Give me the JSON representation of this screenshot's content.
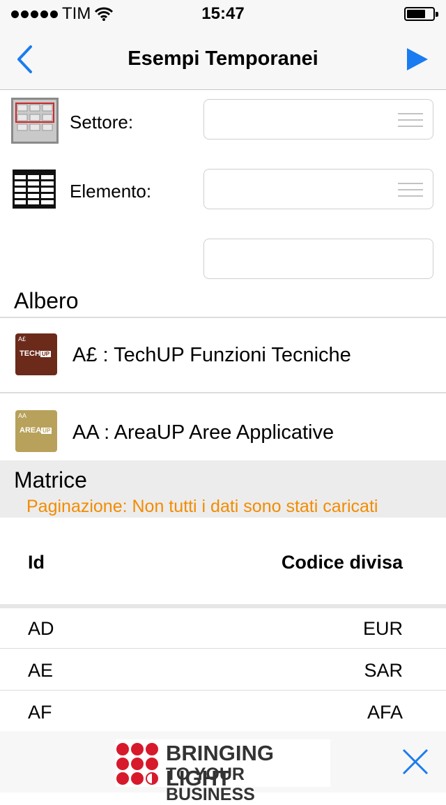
{
  "status": {
    "carrier": "TIM",
    "time": "15:47"
  },
  "nav": {
    "title": "Esempi Temporanei",
    "back_icon": "chevron-left-icon",
    "run_icon": "play-icon",
    "accent": "#1a7cf0"
  },
  "form": {
    "fields": [
      {
        "label": "Settore:",
        "value": ""
      },
      {
        "label": "Elemento:",
        "value": ""
      },
      {
        "label": "",
        "value": ""
      }
    ]
  },
  "tree": {
    "title": "Albero",
    "items": [
      {
        "text": "A£ : TechUP Funzioni Tecniche",
        "icon_small": "A£",
        "icon_big": "TECH",
        "icon_up": "UP",
        "color": "#6b2a1a"
      },
      {
        "text": "AA : AreaUP Aree Applicative",
        "icon_small": "AA",
        "icon_big": "AREA",
        "icon_up": "UP",
        "color": "#b8a15a"
      }
    ]
  },
  "matrix": {
    "title": "Matrice",
    "pagination": "Paginazione: Non tutti i dati sono stati caricati",
    "pagination_color": "#f28c00",
    "columns": [
      "Id",
      "Codice divisa"
    ],
    "rows": [
      [
        "AD",
        "EUR"
      ],
      [
        "AE",
        "SAR"
      ],
      [
        "AF",
        "AFA"
      ]
    ]
  },
  "footer": {
    "banner_line1": "BRINGING LIGHT",
    "banner_line2": "TO YOUR BUSINESS",
    "close_icon": "close-icon"
  }
}
